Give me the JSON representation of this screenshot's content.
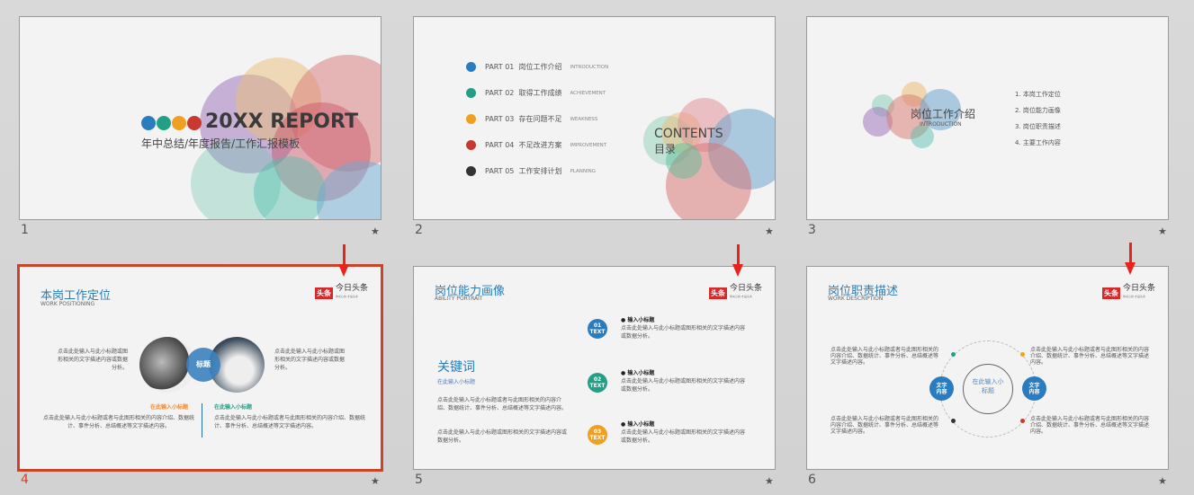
{
  "slides": [
    {
      "number": "1",
      "title": "20XX REPORT",
      "subtitle": "年中总结/年度报告/工作汇报模板",
      "dot_colors": [
        "#2a7cc0",
        "#21a086",
        "#f0a020",
        "#c8392f"
      ]
    },
    {
      "number": "2",
      "contents_en": "CONTENTS",
      "contents_cn": "目录",
      "parts": [
        {
          "label": "PART 01",
          "cn": "岗位工作介绍",
          "en": "INTRODUCTION",
          "color": "#2a7cc0"
        },
        {
          "label": "PART 02",
          "cn": "取得工作成绩",
          "en": "ACHIEVEMENT",
          "color": "#21a086"
        },
        {
          "label": "PART 03",
          "cn": "存在问题不足",
          "en": "WEAKNESS",
          "color": "#f0a020"
        },
        {
          "label": "PART 04",
          "cn": "不足改进方案",
          "en": "IMPROVEMENT",
          "color": "#c8392f"
        },
        {
          "label": "PART 05",
          "cn": "工作安排计划",
          "en": "PLANNING",
          "color": "#333333"
        }
      ]
    },
    {
      "number": "3",
      "title": "岗位工作介绍",
      "title_en": "INTRODUCTION",
      "list": [
        "1. 本岗工作定位",
        "2. 岗位能力画像",
        "3. 岗位职责描述",
        "4. 主要工作内容"
      ]
    },
    {
      "number": "4",
      "title": "本岗工作定位",
      "title_en": "WORK POSITIONING",
      "center_label": "标题",
      "left_text": "点击此处输入与此小标题或图形相关的文字描述内容或数据分析。",
      "right_text": "点击此处输入与此小标题或图形相关的文字描述内容或数据分析。",
      "sub_left": "在此输入小标题",
      "sub_right": "在此输入小标题",
      "body_left": "点击此处输入与此小标题或者与此图形相关的内容介绍、数据统计、事件分析、总结概述等文字描述内容。",
      "body_right": "点击此处输入与此小标题或者与此图形相关的内容介绍、数据统计、事件分析、总结概述等文字描述内容。"
    },
    {
      "number": "5",
      "title": "岗位能力画像",
      "title_en": "ABILITY PORTRAIT",
      "keyword": "关键词",
      "keyword_sub": "在此输入小标题",
      "keyword_body": "点击此处输入与此小标题或者与此图形相关的内容介绍、数据统计、事件分析、总结概述等文字描述内容。",
      "keyword_body2": "点击此处输入与此小标题或图形相关的文字描述内容或数据分析。",
      "items": [
        {
          "badge": "01",
          "badge2": "TEXT",
          "color": "#2a7cc0",
          "heading": "输入小标题",
          "text": "点击此处输入与此小标题或图形相关的文字描述内容或数据分析。"
        },
        {
          "badge": "02",
          "badge2": "TEXT",
          "color": "#21a086",
          "heading": "输入小标题",
          "text": "点击此处输入与此小标题或图形相关的文字描述内容或数据分析。"
        },
        {
          "badge": "03",
          "badge2": "TEXT",
          "color": "#f0a020",
          "heading": "输入小标题",
          "text": "点击此处输入与此小标题或图形相关的文字描述内容或数据分析。"
        }
      ]
    },
    {
      "number": "6",
      "title": "岗位职责描述",
      "title_en": "WORK DESCRIPTION",
      "center": "在此输入小标题",
      "node_left": "文字内容",
      "node_right": "文字内容",
      "texts": [
        "点击此处输入与此小标题或者与此图形相关的内容介绍、数据统计、事件分析、总结概述等文字描述内容。",
        "点击此处输入与此小标题或者与此图形相关的内容介绍、数据统计、事件分析、总结概述等文字描述内容。",
        "点击此处输入与此小标题或者与此图形相关的内容介绍、数据统计、事件分析、总结概述等文字描述内容。",
        "点击此处输入与此小标题或者与此图形相关的内容介绍、数据统计、事件分析、总结概述等文字描述内容。"
      ]
    }
  ],
  "logo": {
    "badge": "头条",
    "name": "今日头条",
    "tagline": "你关心的 才是头条"
  },
  "colors": {
    "selection": "#c8452b",
    "arrow": "#e8231c",
    "accent": "#2a7cc0"
  }
}
